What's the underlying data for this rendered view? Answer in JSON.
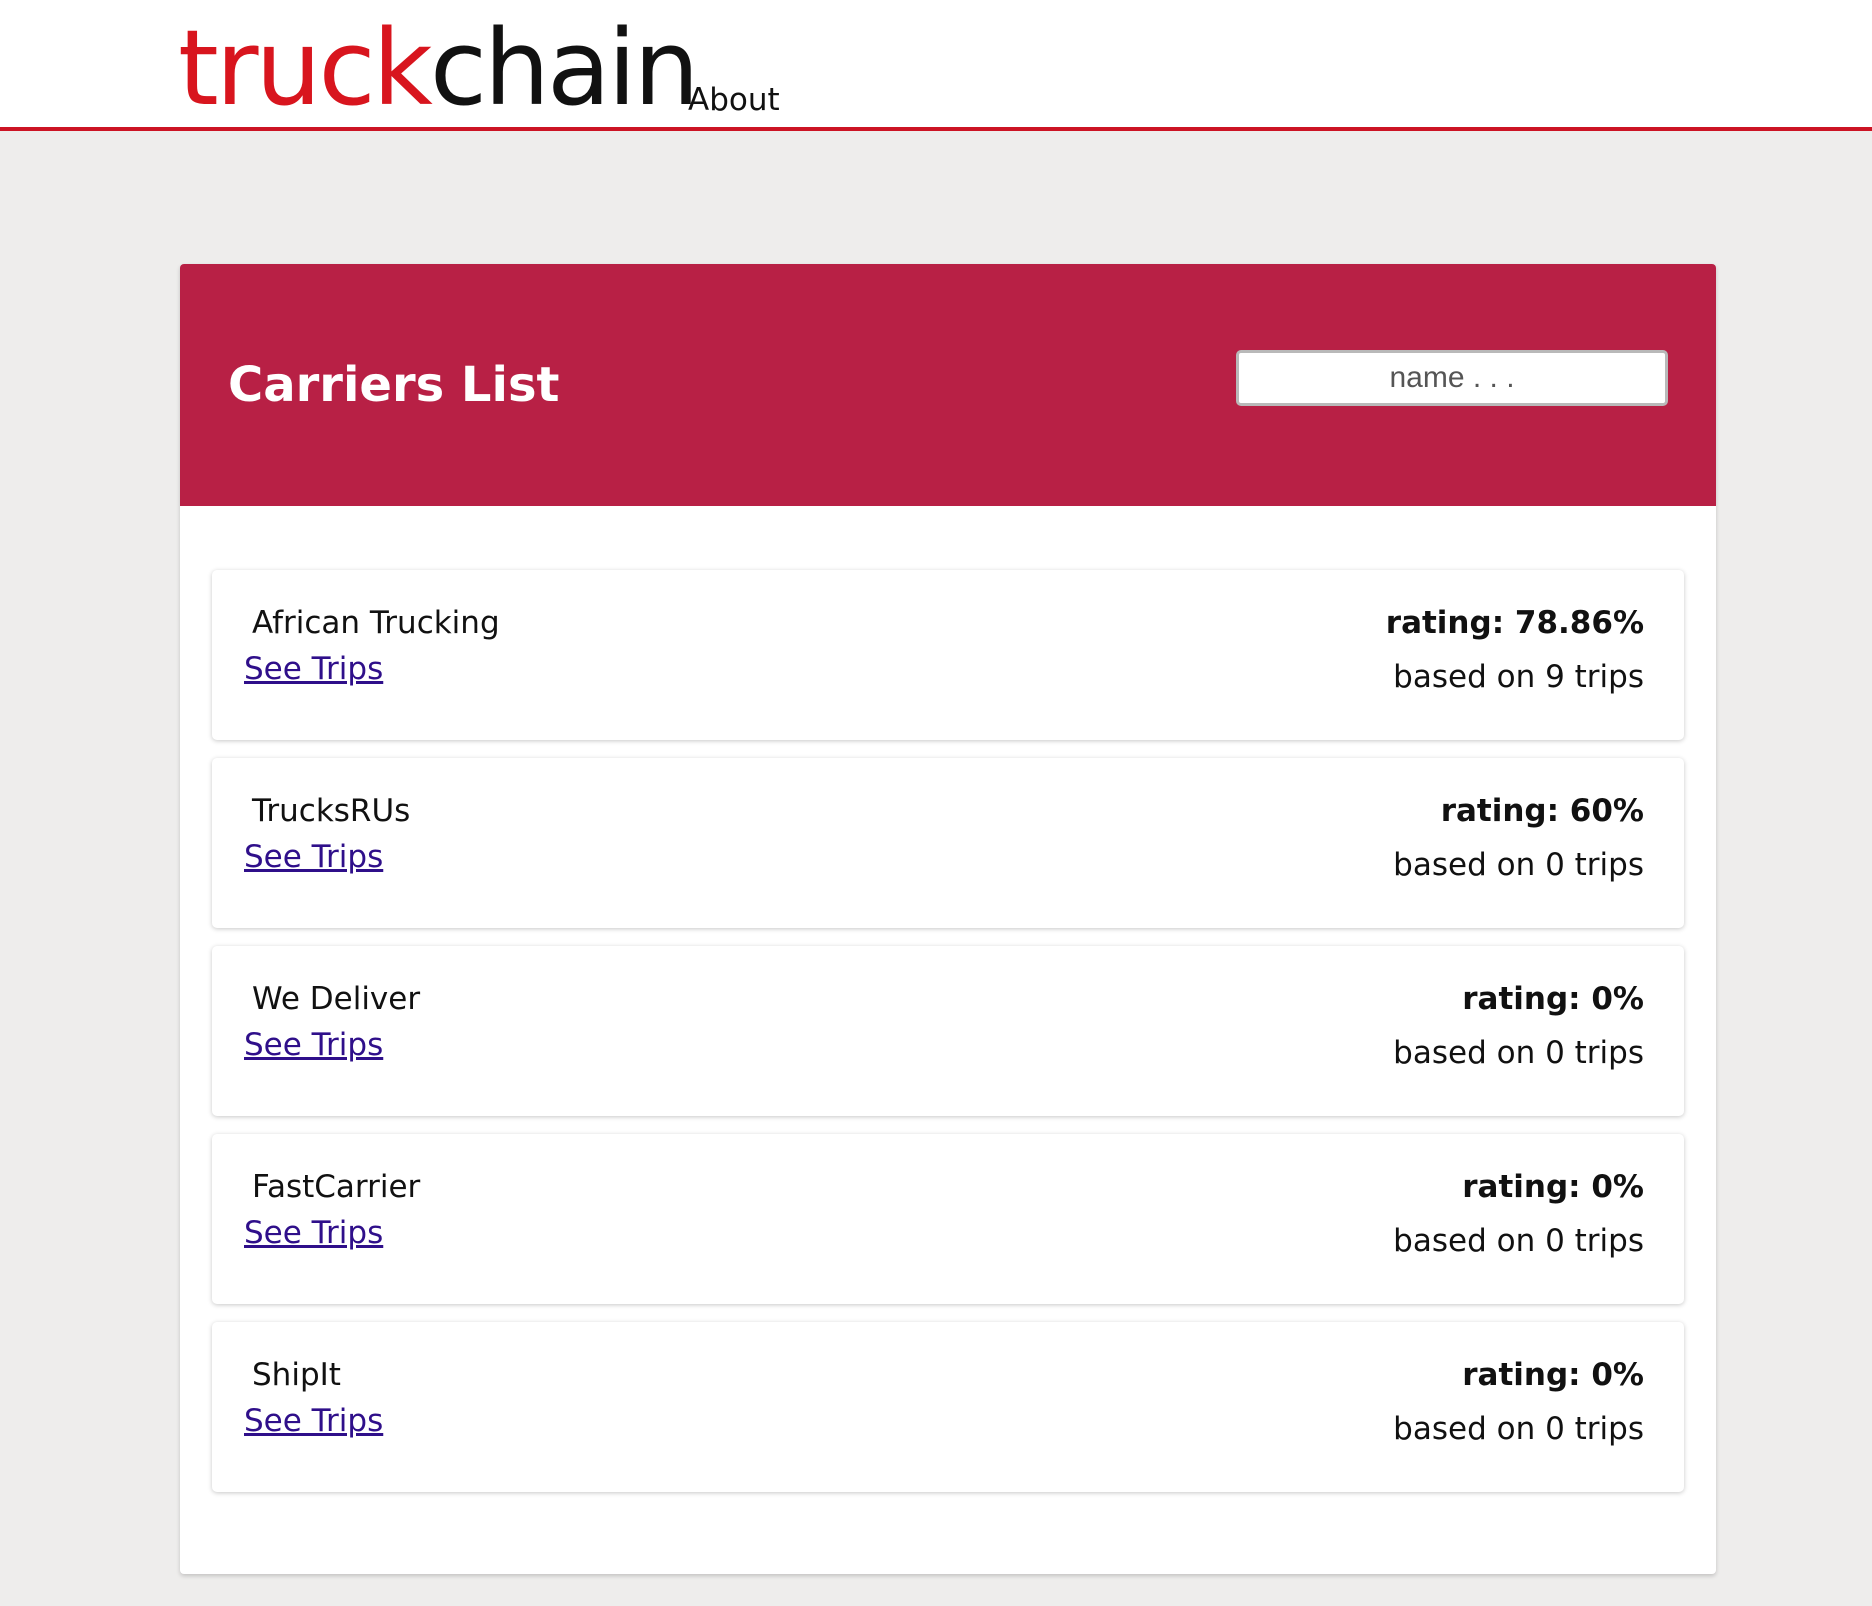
{
  "header": {
    "logo_part1": "truck",
    "logo_part2": "chain",
    "nav_about": "About"
  },
  "panel": {
    "title": "Carriers List",
    "search_placeholder": "name . . ."
  },
  "carriers": [
    {
      "name": "African Trucking",
      "link": "See Trips",
      "rating": "rating: 78.86%",
      "based_on": "based on 9 trips"
    },
    {
      "name": "TrucksRUs",
      "link": "See Trips",
      "rating": "rating: 60%",
      "based_on": "based on 0 trips"
    },
    {
      "name": "We Deliver",
      "link": "See Trips",
      "rating": "rating: 0%",
      "based_on": "based on 0 trips"
    },
    {
      "name": "FastCarrier",
      "link": "See Trips",
      "rating": "rating: 0%",
      "based_on": "based on 0 trips"
    },
    {
      "name": "ShipIt",
      "link": "See Trips",
      "rating": "rating: 0%",
      "based_on": "based on 0 trips"
    }
  ],
  "colors": {
    "brand_red": "#d8151e",
    "header_crimson": "#b82045",
    "link_purple": "#2f0f8a",
    "page_bg": "#eeedec"
  }
}
